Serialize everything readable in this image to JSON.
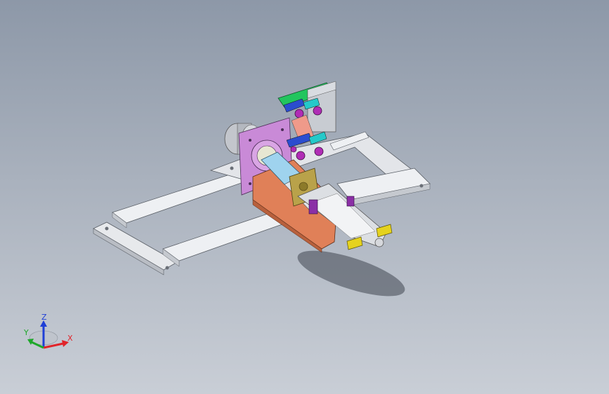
{
  "viewport": {
    "background_top": "#8d98a8",
    "background_bottom": "#c9ced6"
  },
  "triad": {
    "x_label": "X",
    "y_label": "Y",
    "z_label": "Z",
    "x_color": "#e0242a",
    "y_color": "#1ea82a",
    "z_color": "#1f3fd6"
  },
  "model": {
    "part_colors": {
      "frame": "#e4e6ea",
      "plate_violet": "#c98ad7",
      "plate_green": "#22c55e",
      "housing_salmon": "#e08058",
      "cylinder_blue": "#9fd3ee",
      "roller_magenta": "#b02db5",
      "clamp_yellow": "#e5d21e",
      "motor_gray": "#c3c6cc"
    }
  }
}
